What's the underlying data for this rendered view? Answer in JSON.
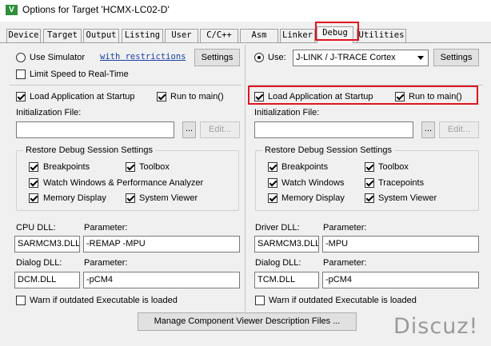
{
  "window": {
    "title": "Options for Target 'HCMX-LC02-D'",
    "icon": "keil-uvision-icon"
  },
  "tabs": [
    {
      "label": "Device",
      "active": false
    },
    {
      "label": "Target",
      "active": false
    },
    {
      "label": "Output",
      "active": false
    },
    {
      "label": "Listing",
      "active": false
    },
    {
      "label": "User",
      "active": false
    },
    {
      "label": "C/C++",
      "active": false
    },
    {
      "label": "Asm",
      "active": false
    },
    {
      "label": "Linker",
      "active": false
    },
    {
      "label": "Debug",
      "active": true
    },
    {
      "label": "Utilities",
      "active": false
    }
  ],
  "left": {
    "use_simulator": {
      "label": "Use Simulator",
      "checked": false
    },
    "restrictions_link": "with restrictions",
    "settings_button": "Settings",
    "limit_speed": {
      "label": "Limit Speed to Real-Time",
      "checked": false
    },
    "load_app": {
      "label": "Load Application at Startup",
      "checked": true
    },
    "run_to_main": {
      "label": "Run to main()",
      "checked": true
    },
    "init_file_label": "Initialization File:",
    "init_file_value": "",
    "browse_button": "...",
    "edit_button": "Edit...",
    "restore_group": "Restore Debug Session Settings",
    "restore_items": [
      {
        "label": "Breakpoints",
        "checked": true
      },
      {
        "label": "Toolbox",
        "checked": true
      },
      {
        "label": "Watch Windows & Performance Analyzer",
        "checked": true
      },
      {
        "label": "Memory Display",
        "checked": true
      },
      {
        "label": "System Viewer",
        "checked": true
      }
    ],
    "dll_label": "CPU DLL:",
    "param_label": "Parameter:",
    "dll_value": "SARMCM3.DLL",
    "dll_param": "-REMAP -MPU",
    "dialog_label": "Dialog DLL:",
    "dialog_param_label": "Parameter:",
    "dialog_value": "DCM.DLL",
    "dialog_param": "-pCM4",
    "warn": {
      "label": "Warn if outdated Executable is loaded",
      "checked": false
    }
  },
  "right": {
    "use": {
      "label": "Use:",
      "checked": true
    },
    "driver_select": "J-LINK / J-TRACE Cortex",
    "settings_button": "Settings",
    "load_app": {
      "label": "Load Application at Startup",
      "checked": true
    },
    "run_to_main": {
      "label": "Run to main()",
      "checked": true
    },
    "init_file_label": "Initialization File:",
    "init_file_value": "",
    "browse_button": "...",
    "edit_button": "Edit...",
    "restore_group": "Restore Debug Session Settings",
    "restore_items": [
      {
        "label": "Breakpoints",
        "checked": true
      },
      {
        "label": "Toolbox",
        "checked": true
      },
      {
        "label": "Watch Windows",
        "checked": true
      },
      {
        "label": "Tracepoints",
        "checked": true
      },
      {
        "label": "Memory Display",
        "checked": true
      },
      {
        "label": "System Viewer",
        "checked": true
      }
    ],
    "dll_label": "Driver DLL:",
    "param_label": "Parameter:",
    "dll_value": "SARMCM3.DLL",
    "dll_param": "-MPU",
    "dialog_label": "Dialog DLL:",
    "dialog_param_label": "Parameter:",
    "dialog_value": "TCM.DLL",
    "dialog_param": "-pCM4",
    "warn": {
      "label": "Warn if outdated Executable is loaded",
      "checked": false
    }
  },
  "manage_button": "Manage Component Viewer Description Files ...",
  "watermark": "Discuz!",
  "colors": {
    "highlight_box": "#e0141e",
    "link": "#1a3fa8",
    "app_icon": "#2f8f3a"
  }
}
